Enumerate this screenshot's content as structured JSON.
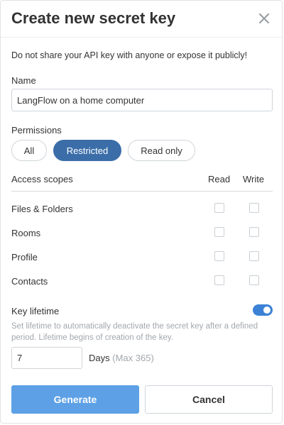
{
  "dialog": {
    "title": "Create new secret key",
    "warning": "Do not share your API key with anyone or expose it publicly!"
  },
  "name": {
    "label": "Name",
    "value": "LangFlow on a home computer"
  },
  "permissions": {
    "label": "Permissions",
    "options": [
      "All",
      "Restricted",
      "Read only"
    ],
    "selected": "Restricted"
  },
  "scopes": {
    "header_label": "Access scopes",
    "read_label": "Read",
    "write_label": "Write",
    "rows": [
      {
        "label": "Files & Folders",
        "read": false,
        "write": false
      },
      {
        "label": "Rooms",
        "read": false,
        "write": false
      },
      {
        "label": "Profile",
        "read": false,
        "write": false
      },
      {
        "label": "Contacts",
        "read": false,
        "write": false
      }
    ]
  },
  "lifetime": {
    "label": "Key lifetime",
    "enabled": true,
    "hint": "Set lifetime to automatically deactivate the secret key after a defined period. Lifetime begins of creation of the key.",
    "days_value": "7",
    "days_label": "Days",
    "days_max": "(Max 365)"
  },
  "actions": {
    "generate_label": "Generate",
    "cancel_label": "Cancel"
  },
  "colors": {
    "accent": "#3b6ea8",
    "toggle": "#3b82d6",
    "primary_button": "#5da0e6",
    "hint_text": "#a2a7ad"
  }
}
